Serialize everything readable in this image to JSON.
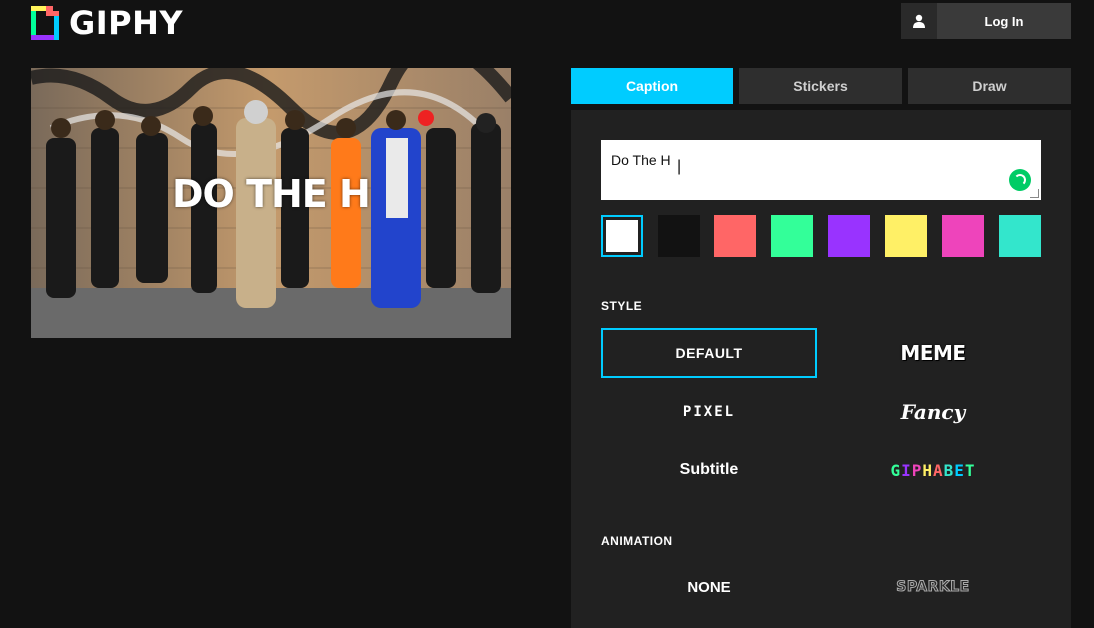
{
  "header": {
    "logo_text": "GIPHY",
    "login_label": "Log In"
  },
  "preview": {
    "caption_overlay": "DO THE H"
  },
  "tabs": [
    {
      "label": "Caption",
      "active": true
    },
    {
      "label": "Stickers",
      "active": false
    },
    {
      "label": "Draw",
      "active": false
    }
  ],
  "caption_input": {
    "value": "Do The H"
  },
  "colors": {
    "accent": "#00ccff",
    "swatches": [
      "#ffffff",
      "#121212",
      "#ff6666",
      "#33ff99",
      "#9933ff",
      "#fff066",
      "#ee44bb",
      "#33e6cc"
    ],
    "selected_index": 0
  },
  "style_section": {
    "label": "STYLE",
    "options": [
      "DEFAULT",
      "MEME",
      "PIXEL",
      "Fancy",
      "Subtitle",
      "GIPHABET"
    ],
    "selected": "DEFAULT"
  },
  "animation_section": {
    "label": "ANIMATION",
    "options": [
      "NONE",
      "SPARKLE"
    ]
  }
}
